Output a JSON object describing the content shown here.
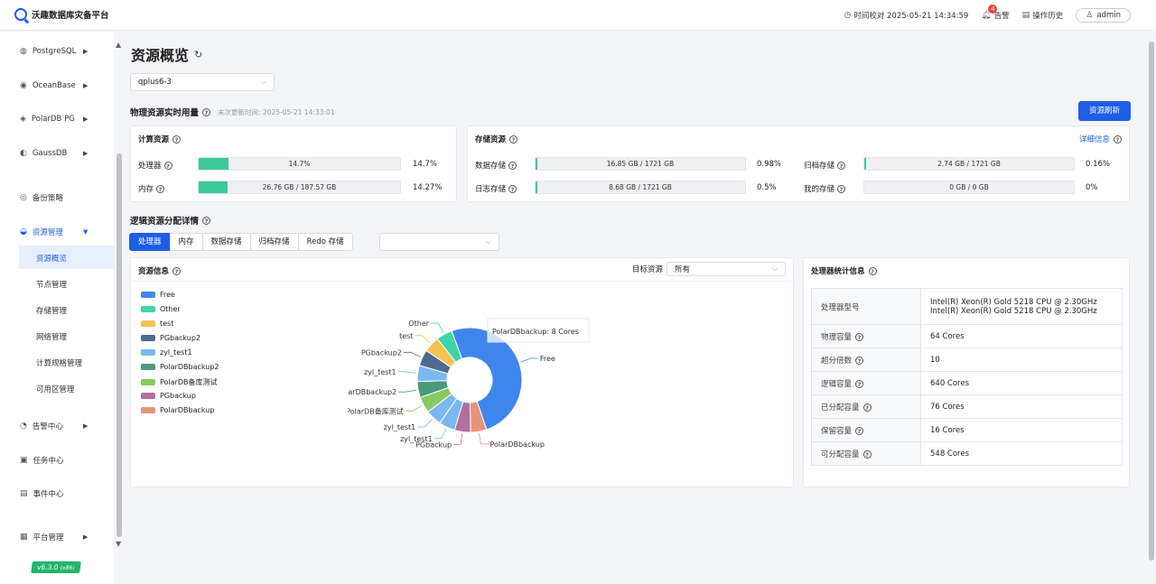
{
  "app": {
    "title": "沃趣数据库灾备平台"
  },
  "topbar": {
    "time_check": "时间校对 2025-05-21 14:34:59",
    "alerts_label": "告警",
    "alerts_count": "4",
    "op_history": "操作历史",
    "user": "admin"
  },
  "sidebar": {
    "items": [
      {
        "label": "PostgreSQL",
        "icon": "postgresql-icon"
      },
      {
        "label": "OceanBase",
        "icon": "oceanbase-icon"
      },
      {
        "label": "PolarDB PG",
        "icon": "polardb-icon"
      },
      {
        "label": "GaussDB",
        "icon": "gaussdb-icon"
      },
      {
        "label": "备份策略",
        "icon": "policy-icon"
      },
      {
        "label": "资源管理",
        "icon": "resource-icon"
      },
      {
        "label": "告警中心",
        "icon": "alarm-icon"
      },
      {
        "label": "任务中心",
        "icon": "task-icon"
      },
      {
        "label": "事件中心",
        "icon": "event-icon"
      },
      {
        "label": "平台管理",
        "icon": "platform-icon"
      }
    ],
    "sub_items": [
      "资源概览",
      "节点管理",
      "存储管理",
      "网络管理",
      "计算规格管理",
      "可用区管理"
    ],
    "version": "v6.3.0",
    "version_arch": "(x86)"
  },
  "page": {
    "title": "资源概览",
    "cluster_select": "qplus6-3",
    "physical_title": "物理资源实时用量",
    "last_update": "末次更新时间: 2025-05-21 14:33:01",
    "refresh_button": "资源刷新"
  },
  "compute": {
    "title": "计算资源",
    "rows": [
      {
        "label": "处理器",
        "text": "14.7%",
        "fraction": 0.147,
        "pct": "14.7%"
      },
      {
        "label": "内存",
        "text": "26.76 GB / 187.57 GB",
        "fraction": 0.1427,
        "pct": "14.27%"
      }
    ]
  },
  "storage": {
    "title": "存储资源",
    "detail_link": "详细信息",
    "rows": [
      {
        "label": "数据存储",
        "text": "16.85 GB / 1721 GB",
        "fraction": 0.0098,
        "pct": "0.98%"
      },
      {
        "label": "日志存储",
        "text": "8.68 GB / 1721 GB",
        "fraction": 0.005,
        "pct": "0.5%"
      },
      {
        "label": "归档存储",
        "text": "2.74 GB / 1721 GB",
        "fraction": 0.0016,
        "pct": "0.16%"
      },
      {
        "label": "我的存储",
        "text": "0 GB / 0 GB",
        "fraction": 0,
        "pct": "0%"
      }
    ]
  },
  "logical": {
    "title": "逻辑资源分配详情",
    "tabs": [
      "处理器",
      "内存",
      "数据存储",
      "归档存储",
      "Redo 存储"
    ],
    "extra_select": ""
  },
  "resource_info": {
    "title": "资源信息",
    "target_label": "目标资源",
    "target_value": "所有",
    "tooltip": "PolarDBbackup: 8 Cores"
  },
  "chart_data": {
    "type": "pie",
    "donut": true,
    "unit": "Cores",
    "legend_position": "left",
    "series": [
      {
        "name": "Free",
        "value": 81,
        "color": "#3f86ec"
      },
      {
        "name": "PolarDBbackup",
        "value": 8,
        "color": "#e8927a"
      },
      {
        "name": "PGbackup",
        "value": 8,
        "color": "#b26fa0"
      },
      {
        "name": "zyl_test1",
        "value": 8,
        "color": "#7ab9f0"
      },
      {
        "name": "zyl_test1",
        "value": 8,
        "color": "#7ab9f0"
      },
      {
        "name": "PolarDB备库测试",
        "value": 8,
        "color": "#88c960"
      },
      {
        "name": "PolarDBbackup2",
        "value": 8,
        "color": "#4a9a7b"
      },
      {
        "name": "zyl_test1",
        "value": 8,
        "color": "#7ab9f0"
      },
      {
        "name": "PGbackup2",
        "value": 8,
        "color": "#4e6a8e"
      },
      {
        "name": "test",
        "value": 8,
        "color": "#f6c251"
      },
      {
        "name": "Other",
        "value": 8,
        "color": "#3ed5a8"
      }
    ],
    "legend": [
      {
        "name": "Free",
        "color": "#3f86ec"
      },
      {
        "name": "Other",
        "color": "#3ed5a8"
      },
      {
        "name": "test",
        "color": "#f6c251"
      },
      {
        "name": "PGbackup2",
        "color": "#4e6a8e"
      },
      {
        "name": "zyl_test1",
        "color": "#7ab9f0"
      },
      {
        "name": "PolarDBbackup2",
        "color": "#4a9a7b"
      },
      {
        "name": "PolarDB备库测试",
        "color": "#88c960"
      },
      {
        "name": "PGbackup",
        "color": "#b26fa0"
      },
      {
        "name": "PolarDBbackup",
        "color": "#e8927a"
      }
    ]
  },
  "cpu_stats": {
    "title": "处理器统计信息",
    "rows": [
      {
        "label": "处理器型号",
        "value": "Intel(R) Xeon(R) Gold 5218 CPU @ 2.30GHz",
        "value2": "Intel(R) Xeon(R) Gold 5218 CPU @ 2.30GHz",
        "help": false
      },
      {
        "label": "物理容量",
        "value": "64 Cores",
        "help": true
      },
      {
        "label": "超分倍数",
        "value": "10",
        "help": true
      },
      {
        "label": "逻辑容量",
        "value": "640 Cores",
        "help": true
      },
      {
        "label": "已分配容量",
        "value": "76 Cores",
        "help": true
      },
      {
        "label": "保留容量",
        "value": "16 Cores",
        "help": true
      },
      {
        "label": "可分配容量",
        "value": "548 Cores",
        "help": true
      }
    ]
  }
}
